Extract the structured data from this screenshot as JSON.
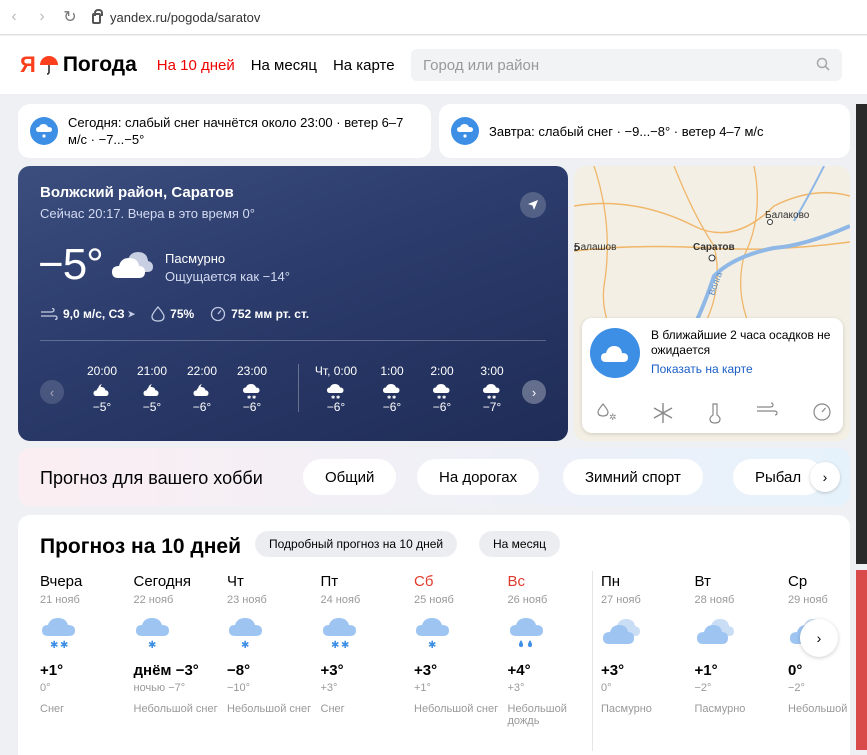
{
  "browser": {
    "url": "yandex.ru/pogoda/saratov"
  },
  "header": {
    "logo_letter": "Я",
    "logo_text": "Погода",
    "nav": [
      "На 10 дней",
      "На месяц",
      "На карте"
    ],
    "search_placeholder": "Город или район"
  },
  "alerts": {
    "today": "Сегодня: слабый снег начнётся около 23:00 · ветер 6–7 м/с · −7...−5°",
    "tomorrow": "Завтра: слабый снег · −9...−8° · ветер 4–7 м/с"
  },
  "current": {
    "location": "Волжский район, Саратов",
    "now_text": "Сейчас 20:17. Вчера в это время 0°",
    "temp": "−5°",
    "condition": "Пасмурно",
    "feels_like": "Ощущается как −14°",
    "wind": "9,0 м/с, СЗ",
    "humidity": "75%",
    "pressure": "752 мм рт. ст.",
    "hours": [
      {
        "time": "20:00",
        "icon": "cloud-moon-icon",
        "temp": "−5°"
      },
      {
        "time": "21:00",
        "icon": "cloud-moon-icon",
        "temp": "−5°"
      },
      {
        "time": "22:00",
        "icon": "cloud-moon-icon",
        "temp": "−6°"
      },
      {
        "time": "23:00",
        "icon": "cloud-snow-icon",
        "temp": "−6°"
      },
      {
        "time": "Чт, 0:00",
        "icon": "cloud-snow-icon",
        "temp": "−6°"
      },
      {
        "time": "1:00",
        "icon": "cloud-snow-icon",
        "temp": "−6°"
      },
      {
        "time": "2:00",
        "icon": "cloud-snow-icon",
        "temp": "−6°"
      },
      {
        "time": "3:00",
        "icon": "cloud-snow-icon",
        "temp": "−7°"
      }
    ]
  },
  "map": {
    "labels": [
      "Балаково",
      "Балашов",
      "Саратов",
      "Волга"
    ],
    "message": "В ближайшие 2 часа осадков не ожидается",
    "link": "Показать на карте"
  },
  "hobby": {
    "title": "Прогноз для вашего хобби",
    "chips": [
      "Общий",
      "На дорогах",
      "Зимний спорт",
      "Рыбал"
    ]
  },
  "forecast": {
    "title": "Прогноз на 10 дней",
    "detail_button": "Подробный прогноз на 10 дней",
    "month_button": "На месяц",
    "days": [
      {
        "name": "Вчера",
        "date": "21 нояб",
        "icon": "cloud-snow-icon",
        "day": "+1°",
        "night": "0°",
        "cond": "Снег",
        "weekend": false
      },
      {
        "name": "Сегодня",
        "date": "22 нояб",
        "icon": "cloud-light-snow-icon",
        "day": "днём −3°",
        "night": "ночью −7°",
        "cond": "Небольшой снег",
        "weekend": false
      },
      {
        "name": "Чт",
        "date": "23 нояб",
        "icon": "cloud-light-snow-icon",
        "day": "−8°",
        "night": "−10°",
        "cond": "Небольшой снег",
        "weekend": false
      },
      {
        "name": "Пт",
        "date": "24 нояб",
        "icon": "cloud-snow-icon",
        "day": "+3°",
        "night": "+3°",
        "cond": "Снег",
        "weekend": false
      },
      {
        "name": "Сб",
        "date": "25 нояб",
        "icon": "cloud-light-snow-icon",
        "day": "+3°",
        "night": "+1°",
        "cond": "Небольшой снег",
        "weekend": true
      },
      {
        "name": "Вс",
        "date": "26 нояб",
        "icon": "cloud-rain-icon",
        "day": "+4°",
        "night": "+3°",
        "cond": "Небольшой дождь",
        "weekend": true
      },
      {
        "name": "Пн",
        "date": "27 нояб",
        "icon": "overcast-icon",
        "day": "+3°",
        "night": "0°",
        "cond": "Пасмурно",
        "weekend": false
      },
      {
        "name": "Вт",
        "date": "28 нояб",
        "icon": "overcast-icon",
        "day": "+1°",
        "night": "−2°",
        "cond": "Пасмурно",
        "weekend": false
      },
      {
        "name": "Ср",
        "date": "29 нояб",
        "icon": "overcast-icon",
        "day": "0°",
        "night": "−2°",
        "cond": "Небольшой снег",
        "weekend": false
      }
    ]
  },
  "colors": {
    "accent_red": "#e00000",
    "brand": "#fc3f1d",
    "link": "#1a5ec6",
    "weekend": "#e03c2e"
  }
}
